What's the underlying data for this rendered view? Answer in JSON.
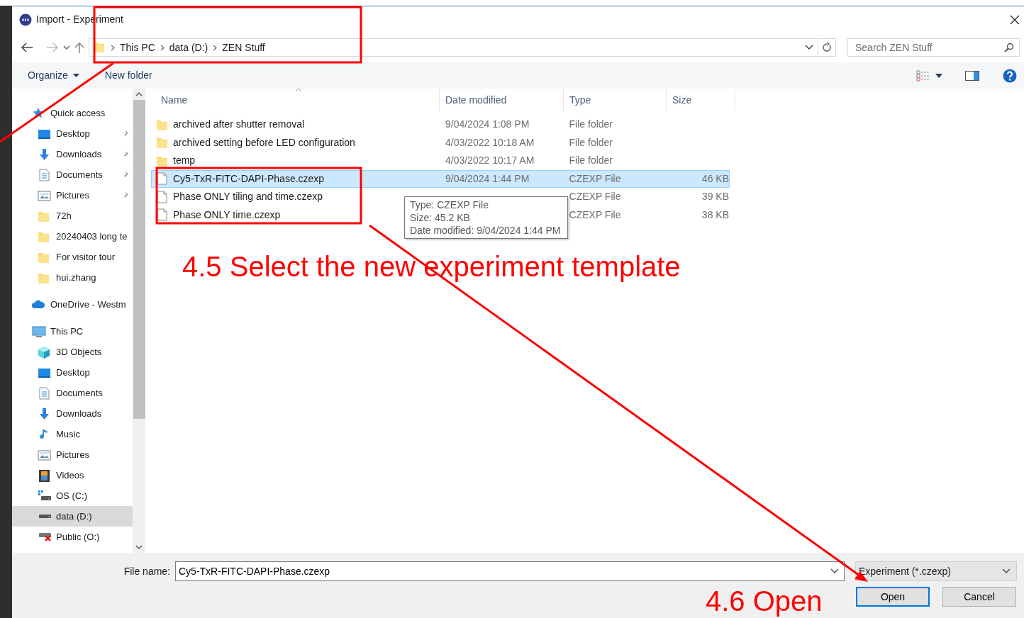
{
  "window": {
    "title": "Import - Experiment"
  },
  "address": {
    "path": [
      "This PC",
      "data (D:)",
      "ZEN Stuff"
    ]
  },
  "search": {
    "placeholder": "Search ZEN Stuff"
  },
  "toolbar": {
    "organize": "Organize",
    "new_folder": "New folder"
  },
  "navigation": [
    {
      "label": "Quick access",
      "kind": "star",
      "selected": false,
      "children": [
        {
          "label": "Desktop",
          "kind": "desktop",
          "pinned": true,
          "selected": false
        },
        {
          "label": "Downloads",
          "kind": "download",
          "pinned": true,
          "selected": false
        },
        {
          "label": "Documents",
          "kind": "document",
          "pinned": true,
          "selected": false
        },
        {
          "label": "Pictures",
          "kind": "pictures",
          "pinned": true,
          "selected": false
        },
        {
          "label": "72h",
          "kind": "folder",
          "pinned": false,
          "selected": false
        },
        {
          "label": "20240403 long te",
          "kind": "folder",
          "pinned": false,
          "selected": false
        },
        {
          "label": "For visitor tour",
          "kind": "folder",
          "pinned": false,
          "selected": false
        },
        {
          "label": "hui.zhang",
          "kind": "folder",
          "pinned": false,
          "selected": false
        }
      ]
    },
    {
      "label": "OneDrive - Westm",
      "kind": "cloud",
      "selected": false
    },
    {
      "label": "This PC",
      "kind": "pc",
      "selected": false,
      "children": [
        {
          "label": "3D Objects",
          "kind": "cube",
          "pinned": false,
          "selected": false
        },
        {
          "label": "Desktop",
          "kind": "desktop",
          "pinned": false,
          "selected": false
        },
        {
          "label": "Documents",
          "kind": "document",
          "pinned": false,
          "selected": false
        },
        {
          "label": "Downloads",
          "kind": "download",
          "pinned": false,
          "selected": false
        },
        {
          "label": "Music",
          "kind": "music",
          "pinned": false,
          "selected": false
        },
        {
          "label": "Pictures",
          "kind": "pictures",
          "pinned": false,
          "selected": false
        },
        {
          "label": "Videos",
          "kind": "video",
          "pinned": false,
          "selected": false
        },
        {
          "label": "OS (C:)",
          "kind": "osdrive",
          "pinned": false,
          "selected": false
        },
        {
          "label": "data (D:)",
          "kind": "drive",
          "pinned": false,
          "selected": true
        },
        {
          "label": "Public (O:)",
          "kind": "netdrive",
          "pinned": false,
          "selected": false
        }
      ]
    }
  ],
  "columns": [
    "Name",
    "Date modified",
    "Type",
    "Size"
  ],
  "files": [
    {
      "name": "archived after shutter removal",
      "date": "9/04/2024 1:08 PM",
      "type": "File folder",
      "kind": "folder",
      "selected": false
    },
    {
      "name": "archived setting before LED configuration",
      "date": "4/03/2022 10:18 AM",
      "type": "File folder",
      "kind": "folder",
      "selected": false
    },
    {
      "name": "temp",
      "date": "4/03/2022 10:17 AM",
      "type": "File folder",
      "kind": "folder",
      "selected": false
    },
    {
      "name": "Cy5-TxR-FITC-DAPI-Phase.czexp",
      "date": "9/04/2024 1:44 PM",
      "type": "CZEXP File",
      "size": "46 KB",
      "kind": "file",
      "selected": true
    },
    {
      "name": "Phase ONLY tiling and time.czexp",
      "type": "CZEXP File",
      "size": "39 KB",
      "kind": "file",
      "selected": false
    },
    {
      "name": "Phase ONLY time.czexp",
      "type": "CZEXP File",
      "size": "38 KB",
      "kind": "file",
      "selected": false
    }
  ],
  "tooltip": [
    "Type: CZEXP File",
    "Size: 45.2 KB",
    "Date modified: 9/04/2024 1:44 PM"
  ],
  "file_name": {
    "label": "File name:",
    "value": "Cy5-TxR-FITC-DAPI-Phase.czexp"
  },
  "file_type": {
    "value": "Experiment (*.czexp)"
  },
  "buttons": [
    {
      "label": "Open",
      "default": true
    },
    {
      "label": "Cancel",
      "default": false
    }
  ],
  "annotations": [
    {
      "text": "4.5 Select the new experiment template"
    },
    {
      "text": "4.6 Open"
    }
  ]
}
